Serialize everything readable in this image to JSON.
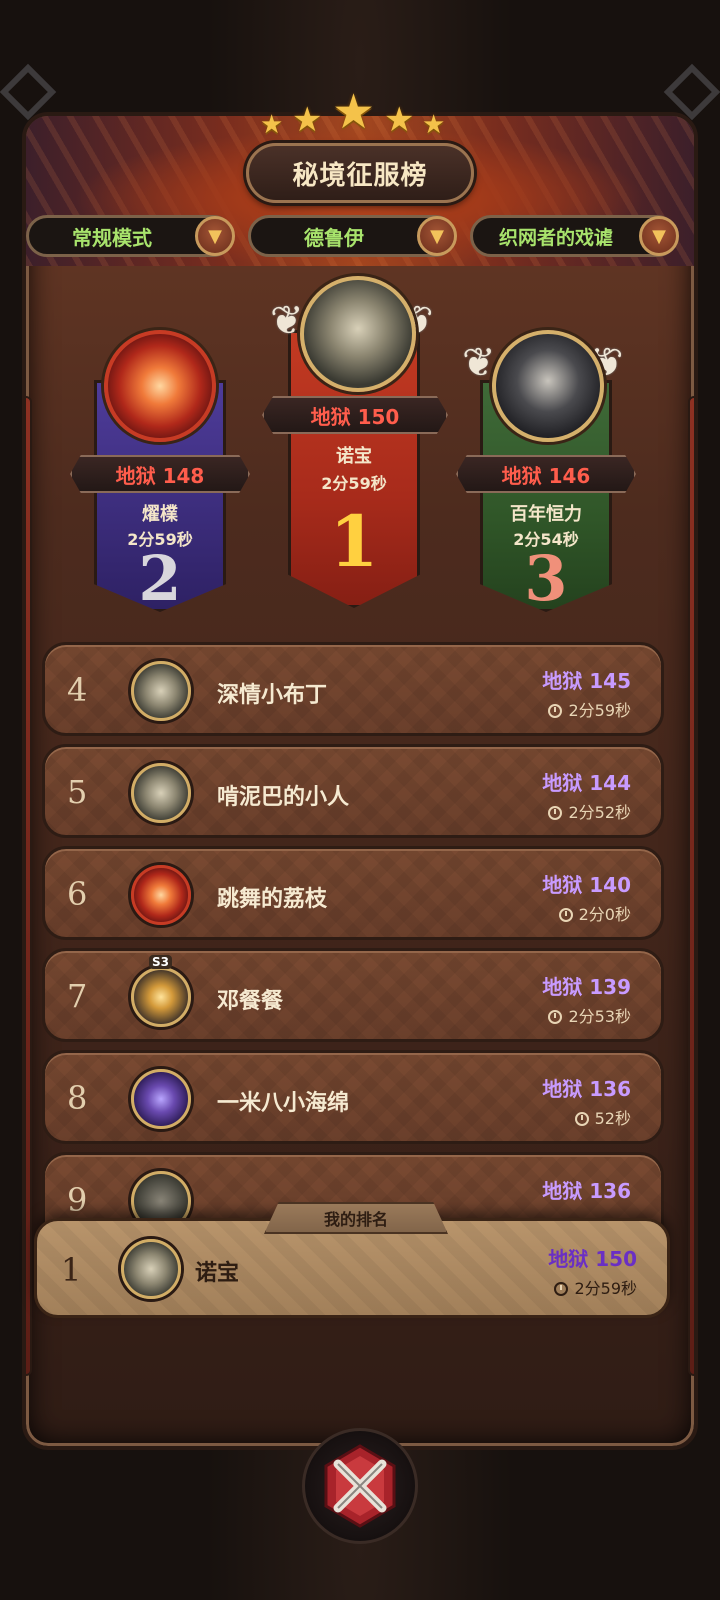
{
  "title": "秘境征服榜",
  "filters": [
    {
      "label": "常规模式"
    },
    {
      "label": "德鲁伊"
    },
    {
      "label": "织网者的戏谑"
    }
  ],
  "podium": [
    {
      "rank": "1",
      "score": "地狱 150",
      "name": "诺宝",
      "time": "2分59秒"
    },
    {
      "rank": "2",
      "score": "地狱 148",
      "name": "燿檏",
      "time": "2分59秒"
    },
    {
      "rank": "3",
      "score": "地狱 146",
      "name": "百年恒力",
      "time": "2分54秒"
    }
  ],
  "rows": [
    {
      "rank": "4",
      "name": "深情小布丁",
      "score": "地狱 145",
      "time": "2分59秒"
    },
    {
      "rank": "5",
      "name": "啃泥巴的小人",
      "score": "地狱 144",
      "time": "2分52秒"
    },
    {
      "rank": "6",
      "name": "跳舞的荔枝",
      "score": "地狱 140",
      "time": "2分0秒"
    },
    {
      "rank": "7",
      "name": "邓餐餐",
      "score": "地狱 139",
      "time": "2分53秒",
      "badge": "S3"
    },
    {
      "rank": "8",
      "name": "一米八小海绵",
      "score": "地狱 136",
      "time": "52秒"
    },
    {
      "rank": "9",
      "name": "",
      "score": "地狱 136",
      "time": ""
    }
  ],
  "my_rank": {
    "tab_label": "我的排名",
    "rank": "1",
    "name": "诺宝",
    "score": "地狱 150",
    "time": "2分59秒"
  },
  "colors": {
    "score_red": "#ff5d4c",
    "score_purple": "#c89bff",
    "filter_green": "#a8e36c",
    "gold": "#f4c24a"
  }
}
